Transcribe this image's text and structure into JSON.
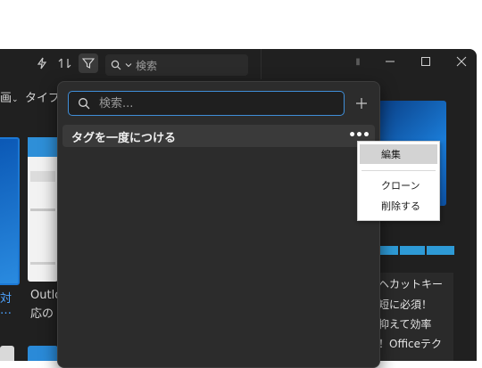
{
  "toolbar": {
    "search_placeholder": "検索",
    "filter_icon": "filter-icon",
    "flash_icon": "flash-icon",
    "sort_icon": "sort-icon"
  },
  "left_partial": {
    "sort_label": "画",
    "type_label": "タイプ",
    "card1_label_line1": "対",
    "card1_label_line2": "…",
    "card2_label_line1": "Outlo",
    "card2_label_line2": "応の"
  },
  "right_partial": {
    "lines": [
      "ヘカットキー",
      "短に必須！",
      "抑えて効率",
      "！Officeテク"
    ]
  },
  "tag_panel": {
    "search_placeholder": "検索...",
    "add_icon": "plus-icon",
    "tag_name": "タグを一度につける",
    "more_icon": "more-dots-icon"
  },
  "context_menu": {
    "items": [
      {
        "label": "編集"
      },
      {
        "label": "クローン"
      },
      {
        "label": "削除する"
      }
    ]
  },
  "colors": {
    "accent": "#3f8ed8",
    "window_bg": "#202020",
    "panel_bg": "#2c2c2c"
  }
}
